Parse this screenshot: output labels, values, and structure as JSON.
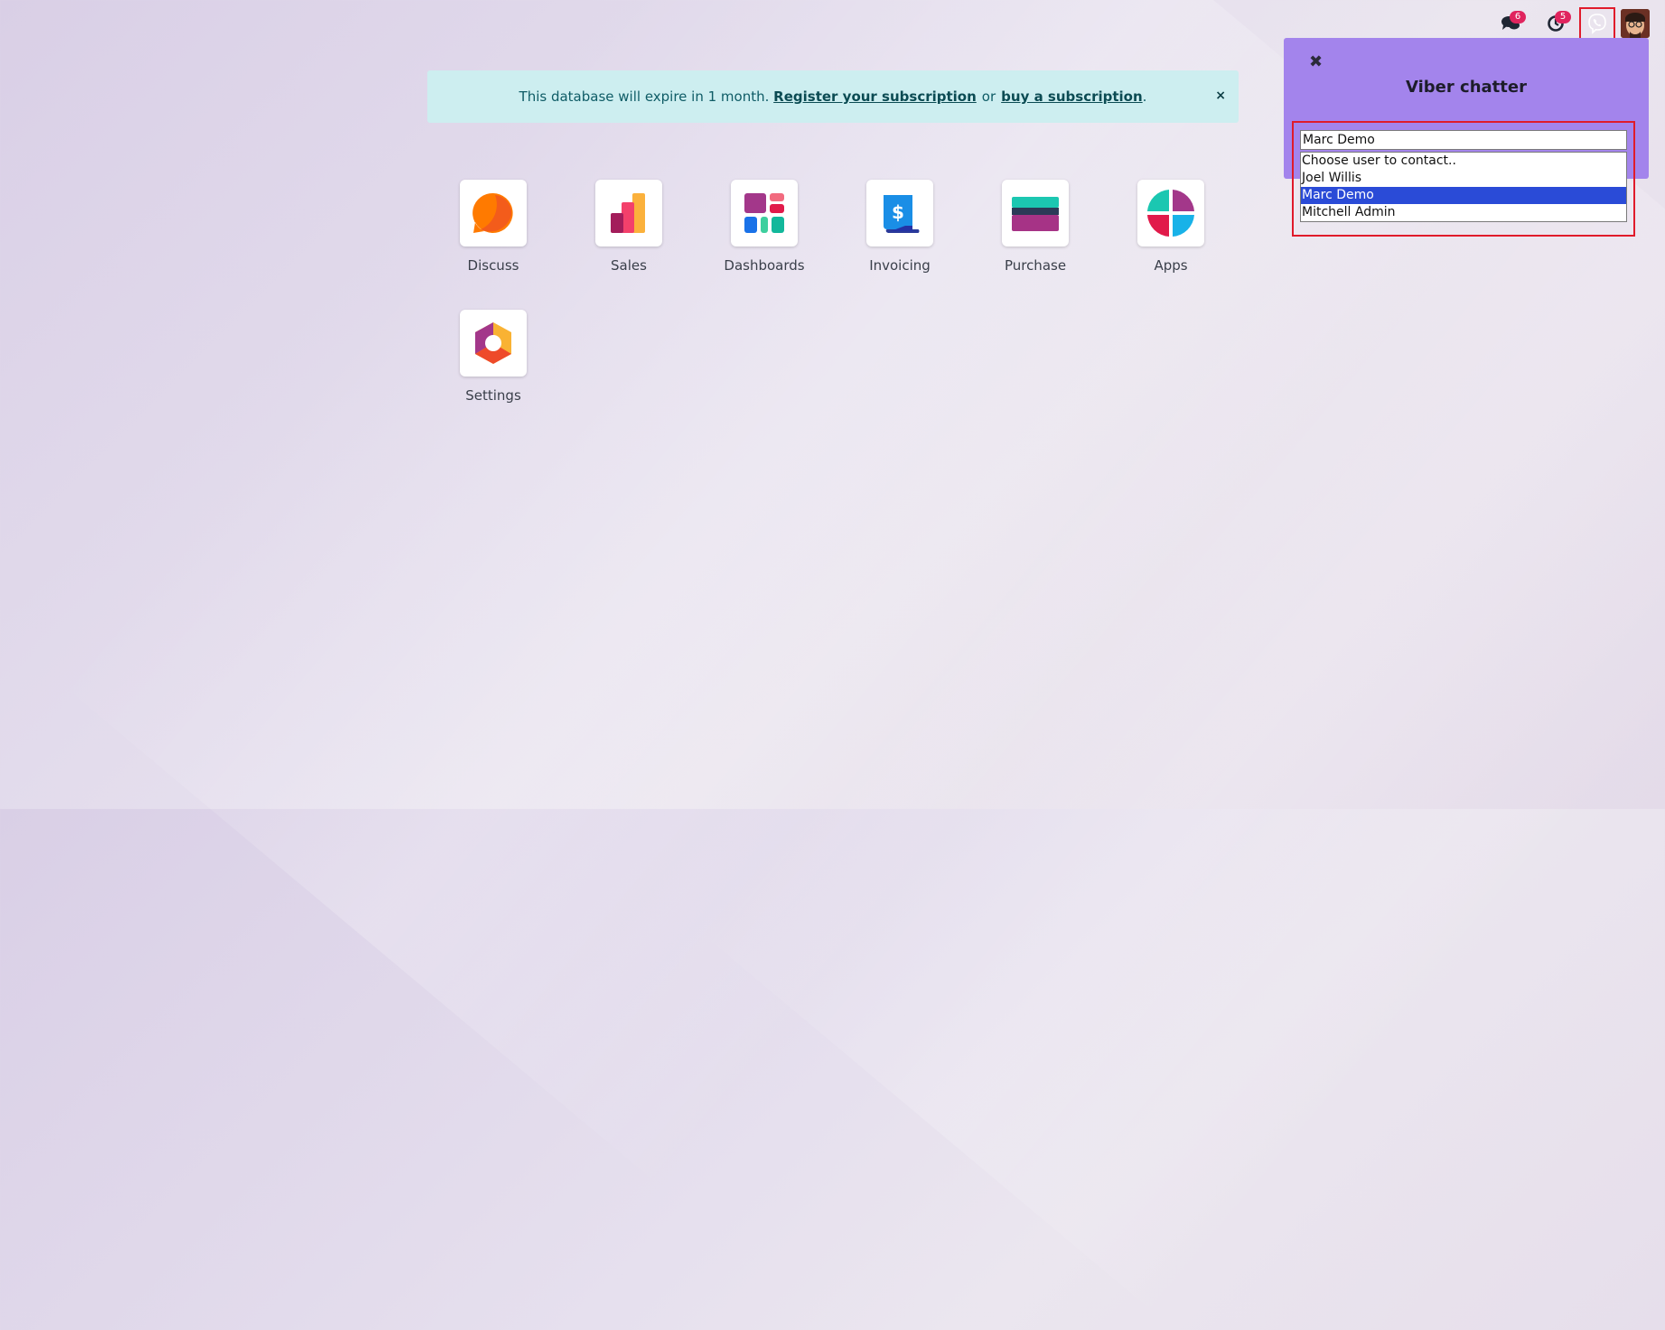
{
  "systray": {
    "chat_count": "6",
    "activity_count": "5",
    "icons": {
      "chat": "chat-bubbles-icon",
      "activity": "clock-icon",
      "viber": "viber-phone-icon"
    }
  },
  "banner": {
    "text": "This database will expire in 1 month.",
    "register_link": "Register your subscription",
    "or": "or",
    "buy_link": "buy a subscription",
    "period": ".",
    "close": "×"
  },
  "apps": [
    {
      "label": "Discuss",
      "icon": "discuss-icon"
    },
    {
      "label": "Sales",
      "icon": "sales-icon"
    },
    {
      "label": "Dashboards",
      "icon": "dashboards-icon"
    },
    {
      "label": "Invoicing",
      "icon": "invoicing-icon"
    },
    {
      "label": "Purchase",
      "icon": "purchase-icon"
    },
    {
      "label": "Apps",
      "icon": "apps-icon"
    },
    {
      "label": "Settings",
      "icon": "settings-icon"
    }
  ],
  "viber": {
    "close": "✖",
    "title": "Viber chatter",
    "selected_value": "Marc Demo",
    "options": [
      "Choose user to contact..",
      "Joel Willis",
      "Marc Demo",
      "Mitchell Admin"
    ],
    "accent": "#a384ec"
  },
  "colors": {
    "badge": "#e0245e",
    "highlight_border": "#e01b2b",
    "option_selected": "#2a4bd7",
    "banner_bg": "#cdeef0"
  }
}
